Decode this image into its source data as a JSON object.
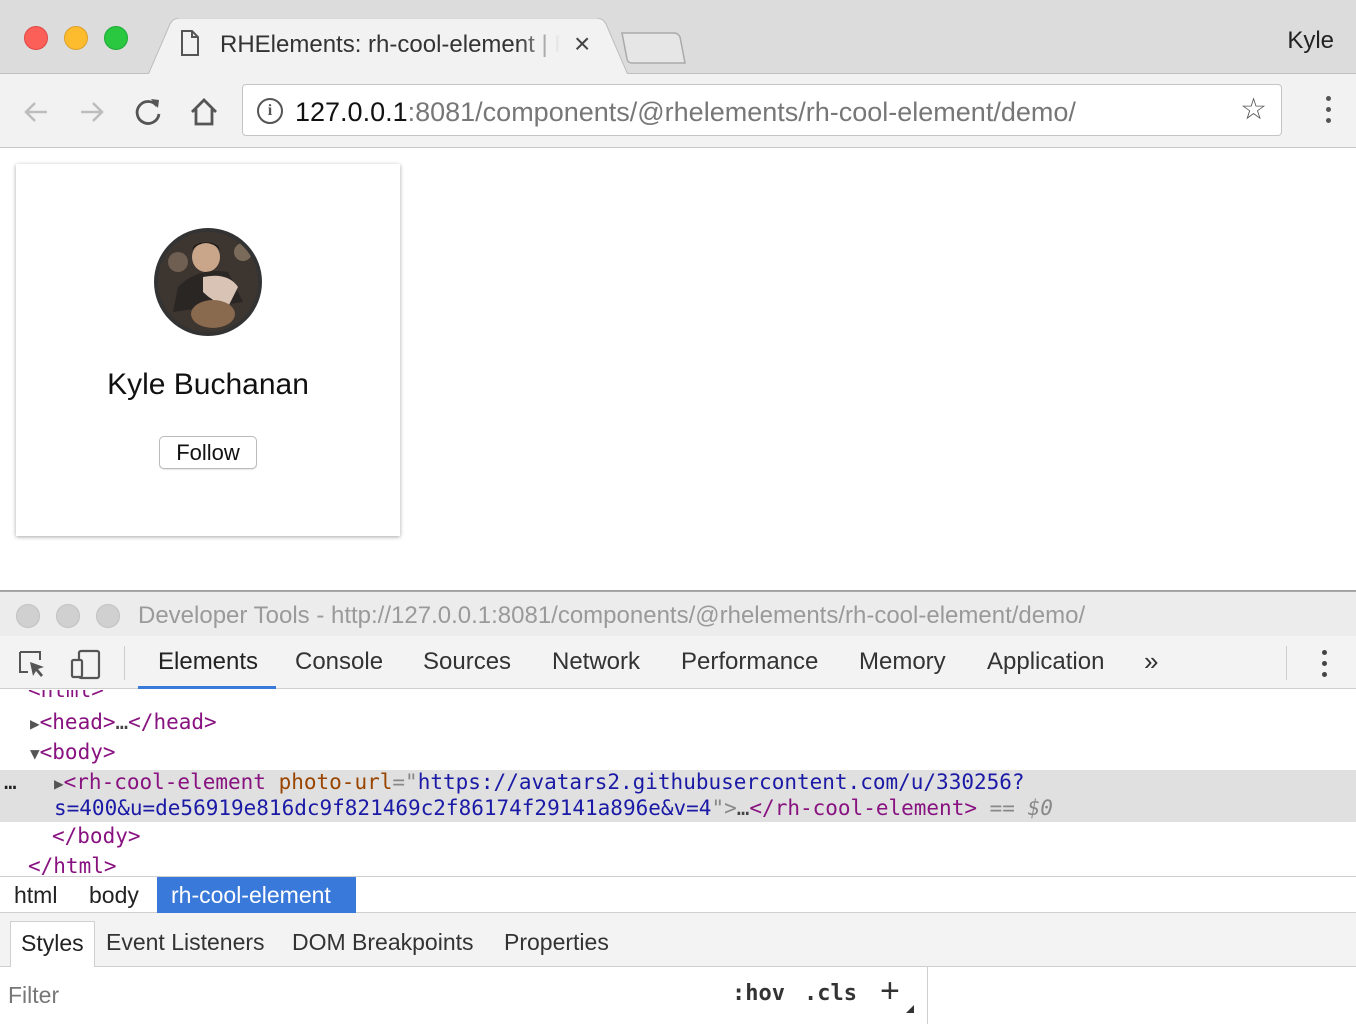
{
  "browser": {
    "tab_title": "RHElements: rh-cool-element | RHElements",
    "profile_name": "Kyle",
    "url_host": "127.0.0.1",
    "url_rest": ":8081/components/@rhelements/rh-cool-element/demo/"
  },
  "card": {
    "name": "Kyle Buchanan",
    "follow_label": "Follow"
  },
  "devtools": {
    "window_title": "Developer Tools - http://127.0.0.1:8081/components/@rhelements/rh-cool-element/demo/",
    "tabs": [
      "Elements",
      "Console",
      "Sources",
      "Network",
      "Performance",
      "Memory",
      "Application"
    ],
    "more_tabs": "»",
    "dom": {
      "html_open": "<html>",
      "head_open": "<head>",
      "head_ellipsis": "…",
      "head_close": "</head>",
      "body_open": "<body>",
      "row_dots": "…",
      "el_open": "<rh-cool-element",
      "attr_name": "photo-url",
      "attr_eq": "=\"",
      "attr_val_1": "https://avatars2.githubusercontent.com/u/330256?",
      "attr_val_2": "s=400&u=de56919e816dc9f821469c2f86174f29141a896e&v=4",
      "attr_end": "\">",
      "el_ellipsis": "…",
      "el_close": "</rh-cool-element>",
      "eq_sign": " == ",
      "dollar0": "$0",
      "body_close": "</body>",
      "html_close": "</html>"
    },
    "breadcrumbs": [
      "html",
      "body",
      "rh-cool-element"
    ],
    "styles_tabs": [
      "Styles",
      "Event Listeners",
      "DOM Breakpoints",
      "Properties"
    ],
    "filter_placeholder": "Filter",
    "hov": ":hov",
    "cls": ".cls",
    "plus": "+"
  },
  "colors": {
    "accent": "#3879d9",
    "tag": "#881280",
    "attr_name": "#994500",
    "attr_value": "#1a1aa6"
  }
}
